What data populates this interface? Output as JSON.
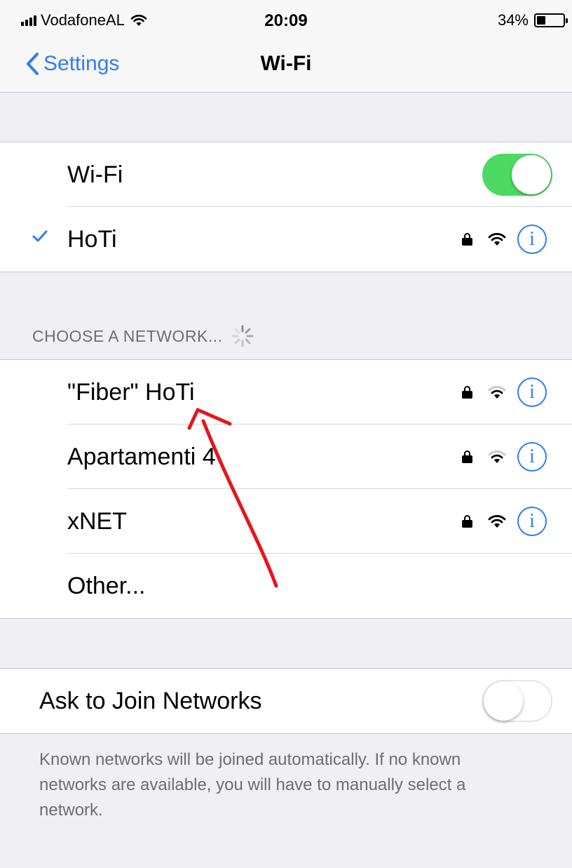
{
  "status_bar": {
    "carrier": "VodafoneAL",
    "time": "20:09",
    "battery_text": "34%",
    "battery_level": 0.34
  },
  "nav": {
    "back_label": "Settings",
    "title": "Wi-Fi"
  },
  "wifi_group": {
    "wifi_label": "Wi-Fi",
    "wifi_on": true,
    "connected_network": "HoTi"
  },
  "choose_header": "CHOOSE A NETWORK...",
  "networks": [
    {
      "name": "\"Fiber\" HoTi",
      "secured": true
    },
    {
      "name": "Apartamenti 4",
      "secured": true
    },
    {
      "name": "xNET",
      "secured": true
    },
    {
      "name": "Other..."
    }
  ],
  "ask_to_join": {
    "label": "Ask to Join Networks",
    "on": false
  },
  "footer_text": "Known networks will be joined automatically. If no known networks are available, you will have to manually select a network.",
  "colors": {
    "accent": "#2f7cf6",
    "toggle_on": "#4cd964",
    "annotation": "#e8141b"
  }
}
